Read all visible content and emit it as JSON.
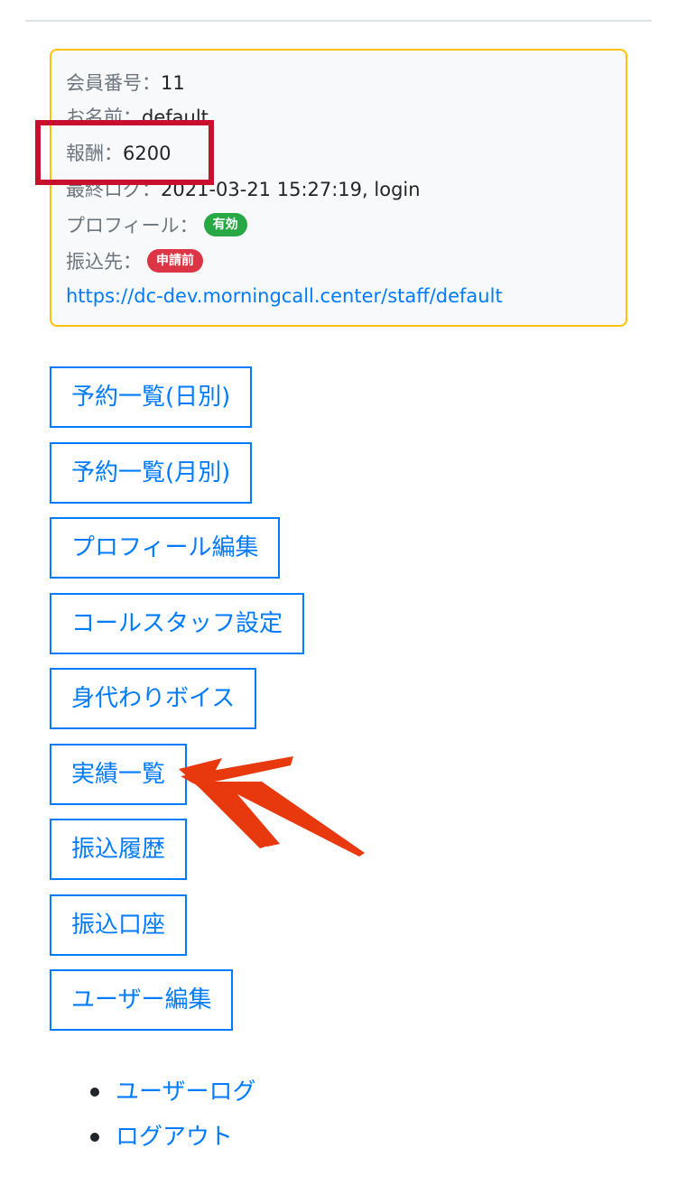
{
  "info": {
    "member_no_label": "会員番号：",
    "member_no_value": "11",
    "name_label": "お名前：",
    "name_value": "default",
    "reward_label": "報酬：",
    "reward_value": "6200",
    "last_login_label": "最終ログ：",
    "last_login_value": "2021-03-21 15:27:19, login",
    "profile_label": "プロフィール：",
    "profile_badge": "有効",
    "transfer_label": "振込先：",
    "transfer_badge": "申請前",
    "staff_url": "https://dc-dev.morningcall.center/staff/default"
  },
  "menu": [
    {
      "label": "予約一覧(日別)"
    },
    {
      "label": "予約一覧(月別)"
    },
    {
      "label": "プロフィール編集"
    },
    {
      "label": "コールスタッフ設定"
    },
    {
      "label": "身代わりボイス"
    },
    {
      "label": "実績一覧"
    },
    {
      "label": "振込履歴"
    },
    {
      "label": "振込口座"
    },
    {
      "label": "ユーザー編集"
    }
  ],
  "links": [
    {
      "label": "ユーザーログ"
    },
    {
      "label": "ログアウト"
    }
  ],
  "colors": {
    "primary": "#007bff",
    "card_border": "#ffc107",
    "badge_active": "#28a745",
    "badge_pending": "#dc3545",
    "highlight": "#c8102e",
    "arrow": "#e8380d"
  }
}
